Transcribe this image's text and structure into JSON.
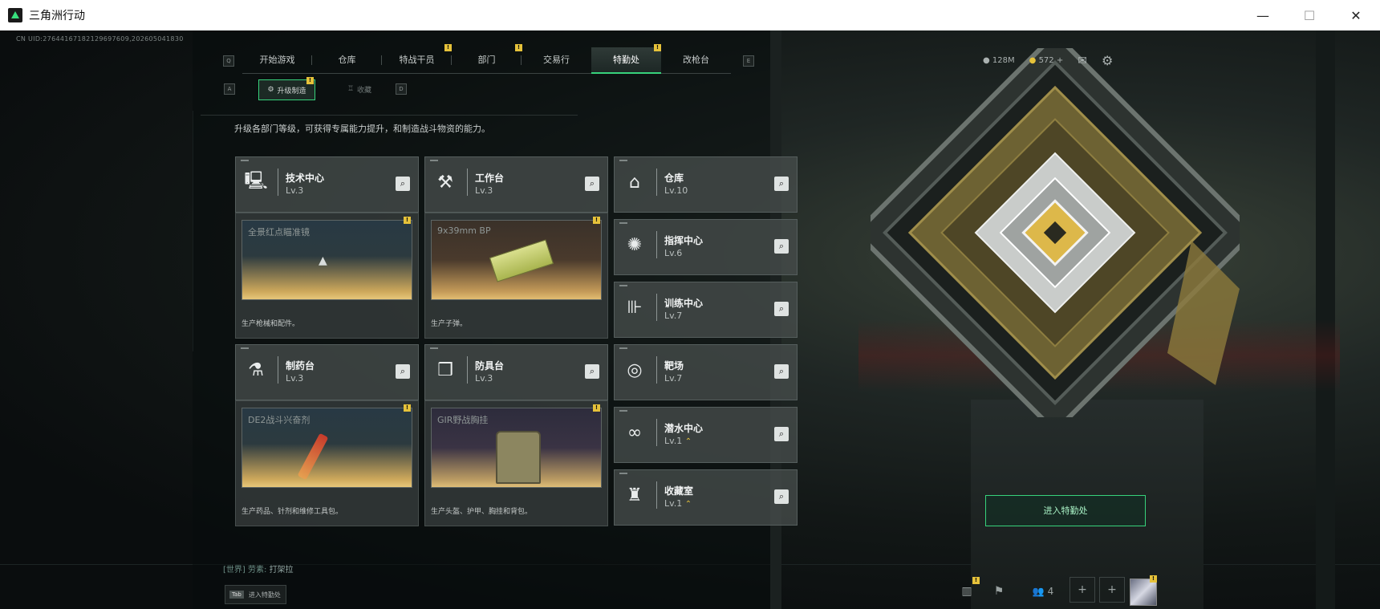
{
  "window": {
    "title": "三角洲行动",
    "minimize": "—",
    "maximize": "☐",
    "close": "✕"
  },
  "uid": "CN UID:27644167182129697609,202605041830",
  "topnav": {
    "left_key": "Q",
    "right_key": "E",
    "tabs": [
      {
        "label": "开始游戏",
        "active": false,
        "badge": ""
      },
      {
        "label": "仓库",
        "active": false,
        "badge": ""
      },
      {
        "label": "特战干员",
        "active": false,
        "badge": "!"
      },
      {
        "label": "部门",
        "active": false,
        "badge": "!"
      },
      {
        "label": "交易行",
        "active": false,
        "badge": ""
      },
      {
        "label": "特勤处",
        "active": true,
        "badge": "!"
      },
      {
        "label": "改枪台",
        "active": false,
        "badge": ""
      }
    ]
  },
  "subtabs": {
    "left_key": "A",
    "right_key": "D",
    "active": "升级制造",
    "inactive": "收藏",
    "badge": "!"
  },
  "description": "升级各部门等级，可获得专属能力提升，和制造战斗物资的能力。",
  "facilities": {
    "tech": {
      "name": "技术中心",
      "level": "Lv.3",
      "icon": "monitor-icon"
    },
    "workbench": {
      "name": "工作台",
      "level": "Lv.3",
      "icon": "hammer-wrench-icon"
    },
    "warehouse": {
      "name": "仓库",
      "level": "Lv.10",
      "icon": "warehouse-icon"
    },
    "command": {
      "name": "指挥中心",
      "level": "Lv.6",
      "icon": "chip-icon"
    },
    "training": {
      "name": "训练中心",
      "level": "Lv.7",
      "icon": "dumbbell-icon"
    },
    "range": {
      "name": "靶场",
      "level": "Lv.7",
      "icon": "target-icon"
    },
    "pharmacy": {
      "name": "制药台",
      "level": "Lv.3",
      "icon": "microscope-icon"
    },
    "armor": {
      "name": "防具台",
      "level": "Lv.3",
      "icon": "cubes-icon"
    },
    "diving": {
      "name": "潜水中心",
      "level": "Lv.1",
      "icon": "goggles-icon"
    },
    "collection": {
      "name": "收藏室",
      "level": "Lv.1",
      "icon": "trophy-icon"
    }
  },
  "products": {
    "tech": {
      "item": "全景红点瞄准镜",
      "caption": "生产枪械和配件。"
    },
    "workbench": {
      "item": "9x39mm BP",
      "caption": "生产子弹。"
    },
    "pharmacy": {
      "item": "DE2战斗兴奋剂",
      "caption": "生产药品、针剂和维修工具包。"
    },
    "armor": {
      "item": "GIR野战胸挂",
      "caption": "生产头盔、护甲、胸挂和背包。"
    }
  },
  "resources": {
    "currency1": "128M",
    "currency2": "572 +"
  },
  "enter_button": "进入特勤处",
  "chat": {
    "channel": "[世界]",
    "sender": "劳素:",
    "message": "打架拉"
  },
  "tab_hint": {
    "key": "Tab",
    "label": "进入特勤处"
  },
  "bottom": {
    "friends_count": "4"
  },
  "colors": {
    "accent": "#37d27b",
    "badge": "#e6c23a",
    "card": "#464d4c"
  }
}
